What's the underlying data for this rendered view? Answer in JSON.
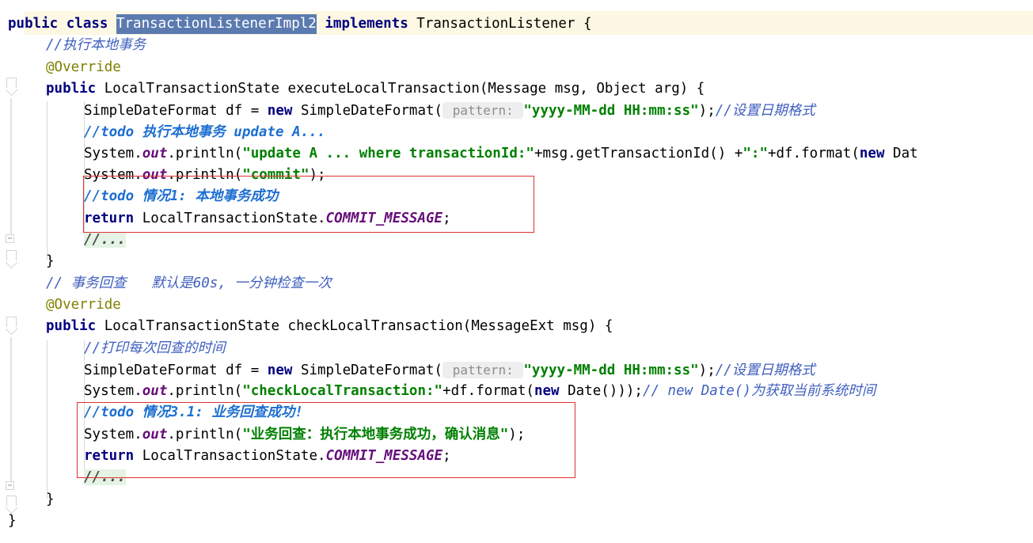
{
  "editor": {
    "language": "java",
    "file_kind": "java-source",
    "colors": {
      "keyword": "#000080",
      "string": "#008000",
      "comment": "#3f5fbf",
      "todo_comment": "#1d6fd0",
      "annotation": "#808000",
      "static_field": "#660e7a",
      "selection_bg": "#5b7bb0",
      "current_line_bg": "#fdf8e3",
      "highlight_green": "#e4f3e4",
      "annotation_box": "#e03030",
      "inlay_hint_bg": "#eeeeee",
      "inlay_hint_fg": "#8d8d8d",
      "indent_guide": "#d8d8d8",
      "fold_marker": "#d4d4d4"
    }
  },
  "code": {
    "lines": [
      {
        "id": "line-class-decl",
        "current": true,
        "segments": [
          {
            "t": "public class ",
            "c": "kw"
          },
          {
            "t": "TransactionListenerImpl2",
            "c": "sel"
          },
          {
            "t": " ",
            "c": "plain"
          },
          {
            "t": "implements",
            "c": "kw"
          },
          {
            "t": " TransactionListener {",
            "c": "plain"
          }
        ]
      },
      {
        "id": "line-comment-exec-local",
        "segments": [
          {
            "t": "//执行本地事务",
            "c": "cmt"
          }
        ]
      },
      {
        "id": "line-override-1",
        "segments": [
          {
            "t": "@Override",
            "c": "anno"
          }
        ]
      },
      {
        "id": "line-exec-signature",
        "segments": [
          {
            "t": "public",
            "c": "kw"
          },
          {
            "t": " LocalTransactionState executeLocalTransaction(Message msg, Object arg) {",
            "c": "plain"
          }
        ]
      },
      {
        "id": "line-sdf-1",
        "segments": [
          {
            "t": "SimpleDateFormat df = ",
            "c": "plain"
          },
          {
            "t": "new",
            "c": "kw"
          },
          {
            "t": " SimpleDateFormat(",
            "c": "plain"
          },
          {
            "t": " pattern: ",
            "c": "hint"
          },
          {
            "t": "\"yyyy-MM-dd HH:mm:ss\"",
            "c": "str"
          },
          {
            "t": ");",
            "c": "plain"
          },
          {
            "t": "//设置日期格式",
            "c": "cmt"
          }
        ]
      },
      {
        "id": "line-todo-update-a",
        "segments": [
          {
            "t": "//todo 执行本地事务 update A...",
            "c": "cmt-todo"
          }
        ]
      },
      {
        "id": "line-println-update-a",
        "segments": [
          {
            "t": "System.",
            "c": "plain"
          },
          {
            "t": "out",
            "c": "field"
          },
          {
            "t": ".println(",
            "c": "plain"
          },
          {
            "t": "\"update A ... where transactionId:\"",
            "c": "str"
          },
          {
            "t": "+msg.getTransactionId() +",
            "c": "plain"
          },
          {
            "t": "\":\"",
            "c": "str"
          },
          {
            "t": "+df.format(",
            "c": "plain"
          },
          {
            "t": "new",
            "c": "kw"
          },
          {
            "t": " Dat",
            "c": "plain"
          }
        ]
      },
      {
        "id": "line-println-commit",
        "segments": [
          {
            "t": "System.",
            "c": "plain"
          },
          {
            "t": "out",
            "c": "field"
          },
          {
            "t": ".println(",
            "c": "plain"
          },
          {
            "t": "\"commit\"",
            "c": "str"
          },
          {
            "t": ");",
            "c": "plain"
          }
        ]
      },
      {
        "id": "line-todo-case1",
        "segments": [
          {
            "t": "//todo 情况1: 本地事务成功",
            "c": "cmt-todo"
          }
        ]
      },
      {
        "id": "line-return-commit-1",
        "segments": [
          {
            "t": "return",
            "c": "kw"
          },
          {
            "t": " LocalTransactionState.",
            "c": "plain"
          },
          {
            "t": "COMMIT_MESSAGE",
            "c": "const"
          },
          {
            "t": ";",
            "c": "plain"
          }
        ]
      },
      {
        "id": "line-dots-1",
        "segments": [
          {
            "t": "//...",
            "c": "dots greenhl"
          }
        ]
      },
      {
        "id": "line-close-method-1",
        "segments": [
          {
            "t": "}",
            "c": "plain"
          }
        ]
      },
      {
        "id": "line-comment-rollback-check",
        "segments": [
          {
            "t": "// 事务回查   默认是60s, 一分钟检查一次",
            "c": "cmt"
          }
        ]
      },
      {
        "id": "line-override-2",
        "segments": [
          {
            "t": "@Override",
            "c": "anno"
          }
        ]
      },
      {
        "id": "line-check-signature",
        "segments": [
          {
            "t": "public",
            "c": "kw"
          },
          {
            "t": " LocalTransactionState checkLocalTransaction(MessageExt msg) {",
            "c": "plain"
          }
        ]
      },
      {
        "id": "line-comment-print-time",
        "segments": [
          {
            "t": "//打印每次回查的时间",
            "c": "cmt"
          }
        ]
      },
      {
        "id": "line-sdf-2",
        "segments": [
          {
            "t": "SimpleDateFormat df = ",
            "c": "plain"
          },
          {
            "t": "new",
            "c": "kw"
          },
          {
            "t": " SimpleDateFormat(",
            "c": "plain"
          },
          {
            "t": " pattern: ",
            "c": "hint"
          },
          {
            "t": "\"yyyy-MM-dd HH:mm:ss\"",
            "c": "str"
          },
          {
            "t": ");",
            "c": "plain"
          },
          {
            "t": "//设置日期格式",
            "c": "cmt"
          }
        ]
      },
      {
        "id": "line-println-check",
        "segments": [
          {
            "t": "System.",
            "c": "plain"
          },
          {
            "t": "out",
            "c": "field"
          },
          {
            "t": ".println(",
            "c": "plain"
          },
          {
            "t": "\"checkLocalTransaction:\"",
            "c": "str"
          },
          {
            "t": "+df.format(",
            "c": "plain"
          },
          {
            "t": "new",
            "c": "kw"
          },
          {
            "t": " Date()));",
            "c": "plain"
          },
          {
            "t": "// new Date()为获取当前系统时间",
            "c": "cmt"
          }
        ]
      },
      {
        "id": "line-todo-case31",
        "segments": [
          {
            "t": "//todo 情况3.1: 业务回查成功!",
            "c": "cmt-todo"
          }
        ]
      },
      {
        "id": "line-println-rollback-ok",
        "segments": [
          {
            "t": "System.",
            "c": "plain"
          },
          {
            "t": "out",
            "c": "field"
          },
          {
            "t": ".println(",
            "c": "plain"
          },
          {
            "t": "\"业务回查：执行本地事务成功，确认消息\"",
            "c": "str"
          },
          {
            "t": ");",
            "c": "plain"
          }
        ]
      },
      {
        "id": "line-return-commit-2",
        "segments": [
          {
            "t": "return",
            "c": "kw"
          },
          {
            "t": " LocalTransactionState.",
            "c": "plain"
          },
          {
            "t": "COMMIT_MESSAGE",
            "c": "const"
          },
          {
            "t": ";",
            "c": "plain"
          }
        ]
      },
      {
        "id": "line-dots-2",
        "segments": [
          {
            "t": "//...",
            "c": "dots greenhl"
          }
        ]
      },
      {
        "id": "line-close-method-2",
        "segments": [
          {
            "t": "}",
            "c": "plain"
          }
        ]
      },
      {
        "id": "line-close-class",
        "segments": [
          {
            "t": "}",
            "c": "plain"
          }
        ]
      }
    ]
  },
  "gutter": {
    "markers": [
      {
        "kind": "fold-arrow",
        "name": "fold-arrow-class-body"
      },
      {
        "kind": "fold-arrow",
        "name": "fold-arrow-execute-method"
      },
      {
        "kind": "fold-box",
        "name": "fold-box-execute-end"
      },
      {
        "kind": "fold-arrow",
        "name": "fold-arrow-check-method"
      },
      {
        "kind": "fold-box",
        "name": "fold-box-check-end"
      }
    ]
  },
  "annotations": {
    "boxes": [
      {
        "name": "red-box-commit-case1",
        "label": "情况1: 本地事务成功 highlight"
      },
      {
        "name": "red-box-check-case31",
        "label": "情况3.1: 业务回查成功 highlight"
      }
    ]
  }
}
